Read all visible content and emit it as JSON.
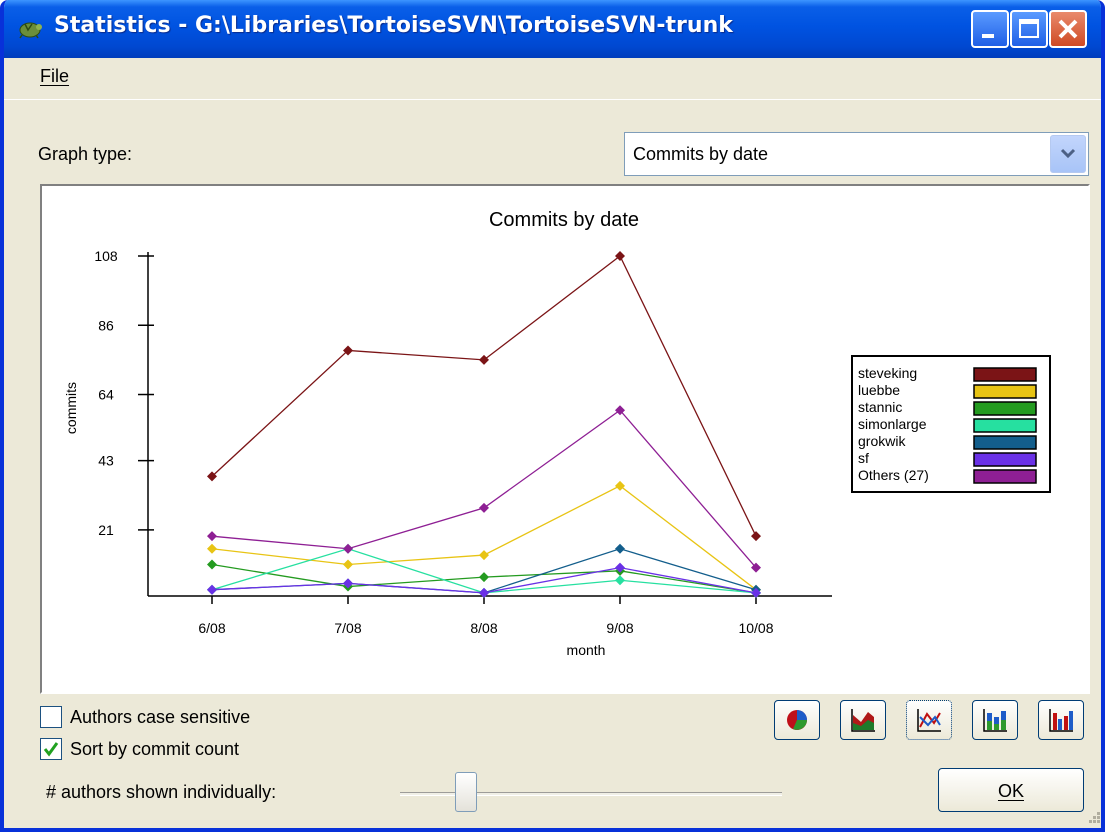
{
  "window": {
    "title": "Statistics - G:\\Libraries\\TortoiseSVN\\TortoiseSVN-trunk"
  },
  "menu": {
    "file": "File"
  },
  "graph_type": {
    "label": "Graph type:",
    "selected": "Commits by date"
  },
  "chart_data": {
    "type": "line",
    "title": "Commits by date",
    "xlabel": "month",
    "ylabel": "commits",
    "categories": [
      "6/08",
      "7/08",
      "8/08",
      "9/08",
      "10/08"
    ],
    "yticks": [
      "108",
      "86",
      "64",
      "43",
      "21"
    ],
    "ylim": [
      0,
      108
    ],
    "legend_position": "right",
    "series": [
      {
        "name": "steveking",
        "color": "#7b1416",
        "values": [
          38,
          78,
          75,
          108,
          19
        ]
      },
      {
        "name": "luebbe",
        "color": "#e8c414",
        "values": [
          15,
          10,
          13,
          35,
          2
        ]
      },
      {
        "name": "stannic",
        "color": "#249b20",
        "values": [
          10,
          3,
          6,
          8,
          1
        ]
      },
      {
        "name": "simonlarge",
        "color": "#26e0a0",
        "values": [
          2,
          15,
          1,
          5,
          1
        ]
      },
      {
        "name": "grokwik",
        "color": "#135e8c",
        "values": [
          2,
          4,
          1,
          15,
          2
        ]
      },
      {
        "name": "sf",
        "color": "#6a31e6",
        "values": [
          2,
          4,
          1,
          9,
          1
        ]
      },
      {
        "name": "Others (27)",
        "color": "#8e1f94",
        "values": [
          19,
          15,
          28,
          59,
          9
        ]
      }
    ]
  },
  "options": {
    "case_sensitive": {
      "label": "Authors case sensitive",
      "checked": false
    },
    "sort_by_count": {
      "label": "Sort by commit count",
      "checked": true
    }
  },
  "authors_slider": {
    "label": "# authors shown individually:"
  },
  "graph_buttons": [
    "pie-chart-icon",
    "stacked-area-icon",
    "line-chart-icon",
    "stacked-bar-icon",
    "grouped-bar-icon"
  ],
  "ok_button": "OK"
}
